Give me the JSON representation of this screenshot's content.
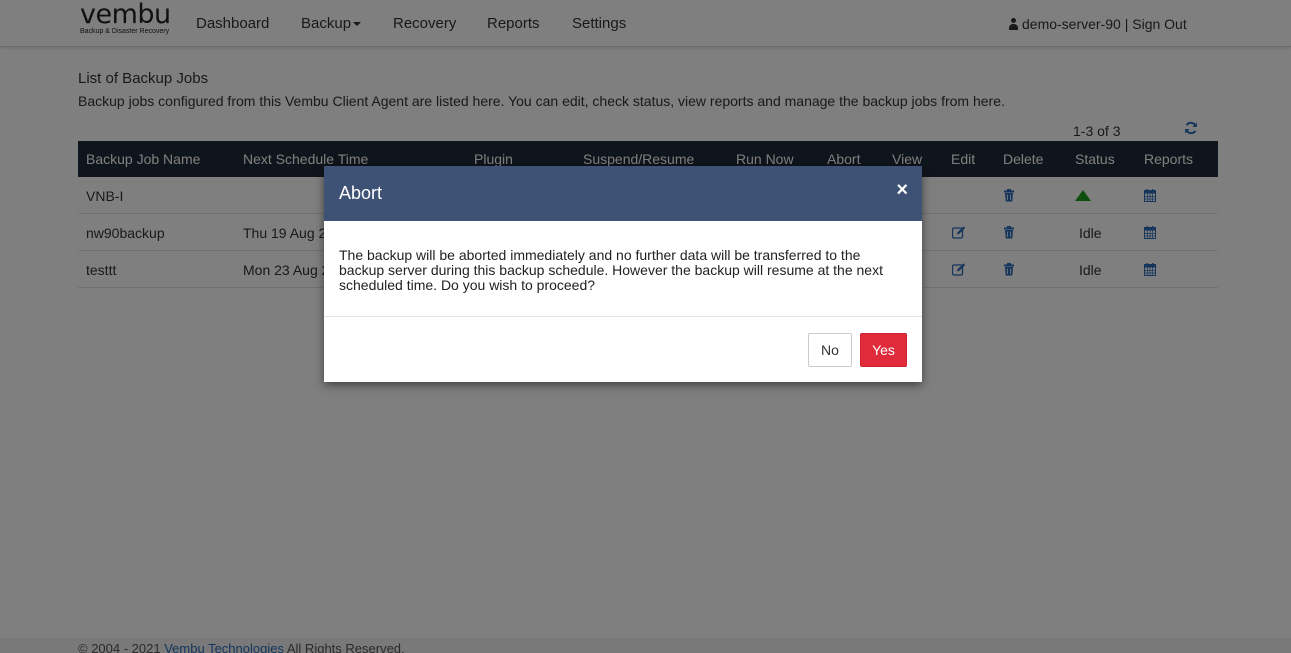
{
  "brand": {
    "name": "vembu",
    "tagline": "Backup & Disaster Recovery"
  },
  "nav": {
    "dashboard": "Dashboard",
    "backup": "Backup",
    "recovery": "Recovery",
    "reports": "Reports",
    "settings": "Settings"
  },
  "user": {
    "name": "demo-server-90",
    "separator": "|",
    "signout": "Sign Out"
  },
  "page": {
    "title": "List of Backup Jobs",
    "description": "Backup jobs configured from this Vembu Client Agent are listed here. You can edit, check status, view reports and manage the backup jobs from here.",
    "pager": "1-3 of 3"
  },
  "table": {
    "headers": [
      "Backup Job Name",
      "Next Schedule Time",
      "Plugin",
      "Suspend/Resume",
      "Run Now",
      "Abort",
      "View",
      "Edit",
      "Delete",
      "Status",
      "Reports"
    ],
    "rows": [
      {
        "name": "VNB-I",
        "schedule": "",
        "status": ""
      },
      {
        "name": "nw90backup",
        "schedule": "Thu 19 Aug 2",
        "status": "Idle"
      },
      {
        "name": "testtt",
        "schedule": "Mon 23 Aug 2",
        "status": "Idle"
      }
    ]
  },
  "footer": {
    "copyright": "© 2004 - 2021",
    "company": "Vembu Technologies",
    "rights": "All Rights Reserved."
  },
  "modal": {
    "title": "Abort",
    "close": "×",
    "message": "The backup will be aborted immediately and no further data will be transferred to the backup server during this backup schedule. However the backup will resume at the next scheduled time. Do you wish to proceed?",
    "no": "No",
    "yes": "Yes"
  },
  "colors": {
    "header_bg": "#1f2b38",
    "modal_header": "#3d5275",
    "yes_button": "#e02b3a",
    "icon_blue": "#2a6ab8",
    "status_running": "#1a9e1a"
  },
  "icons": [
    "user-icon",
    "refresh-icon",
    "edit-icon",
    "trash-icon",
    "calendar-icon",
    "status-running-icon",
    "close-icon"
  ]
}
